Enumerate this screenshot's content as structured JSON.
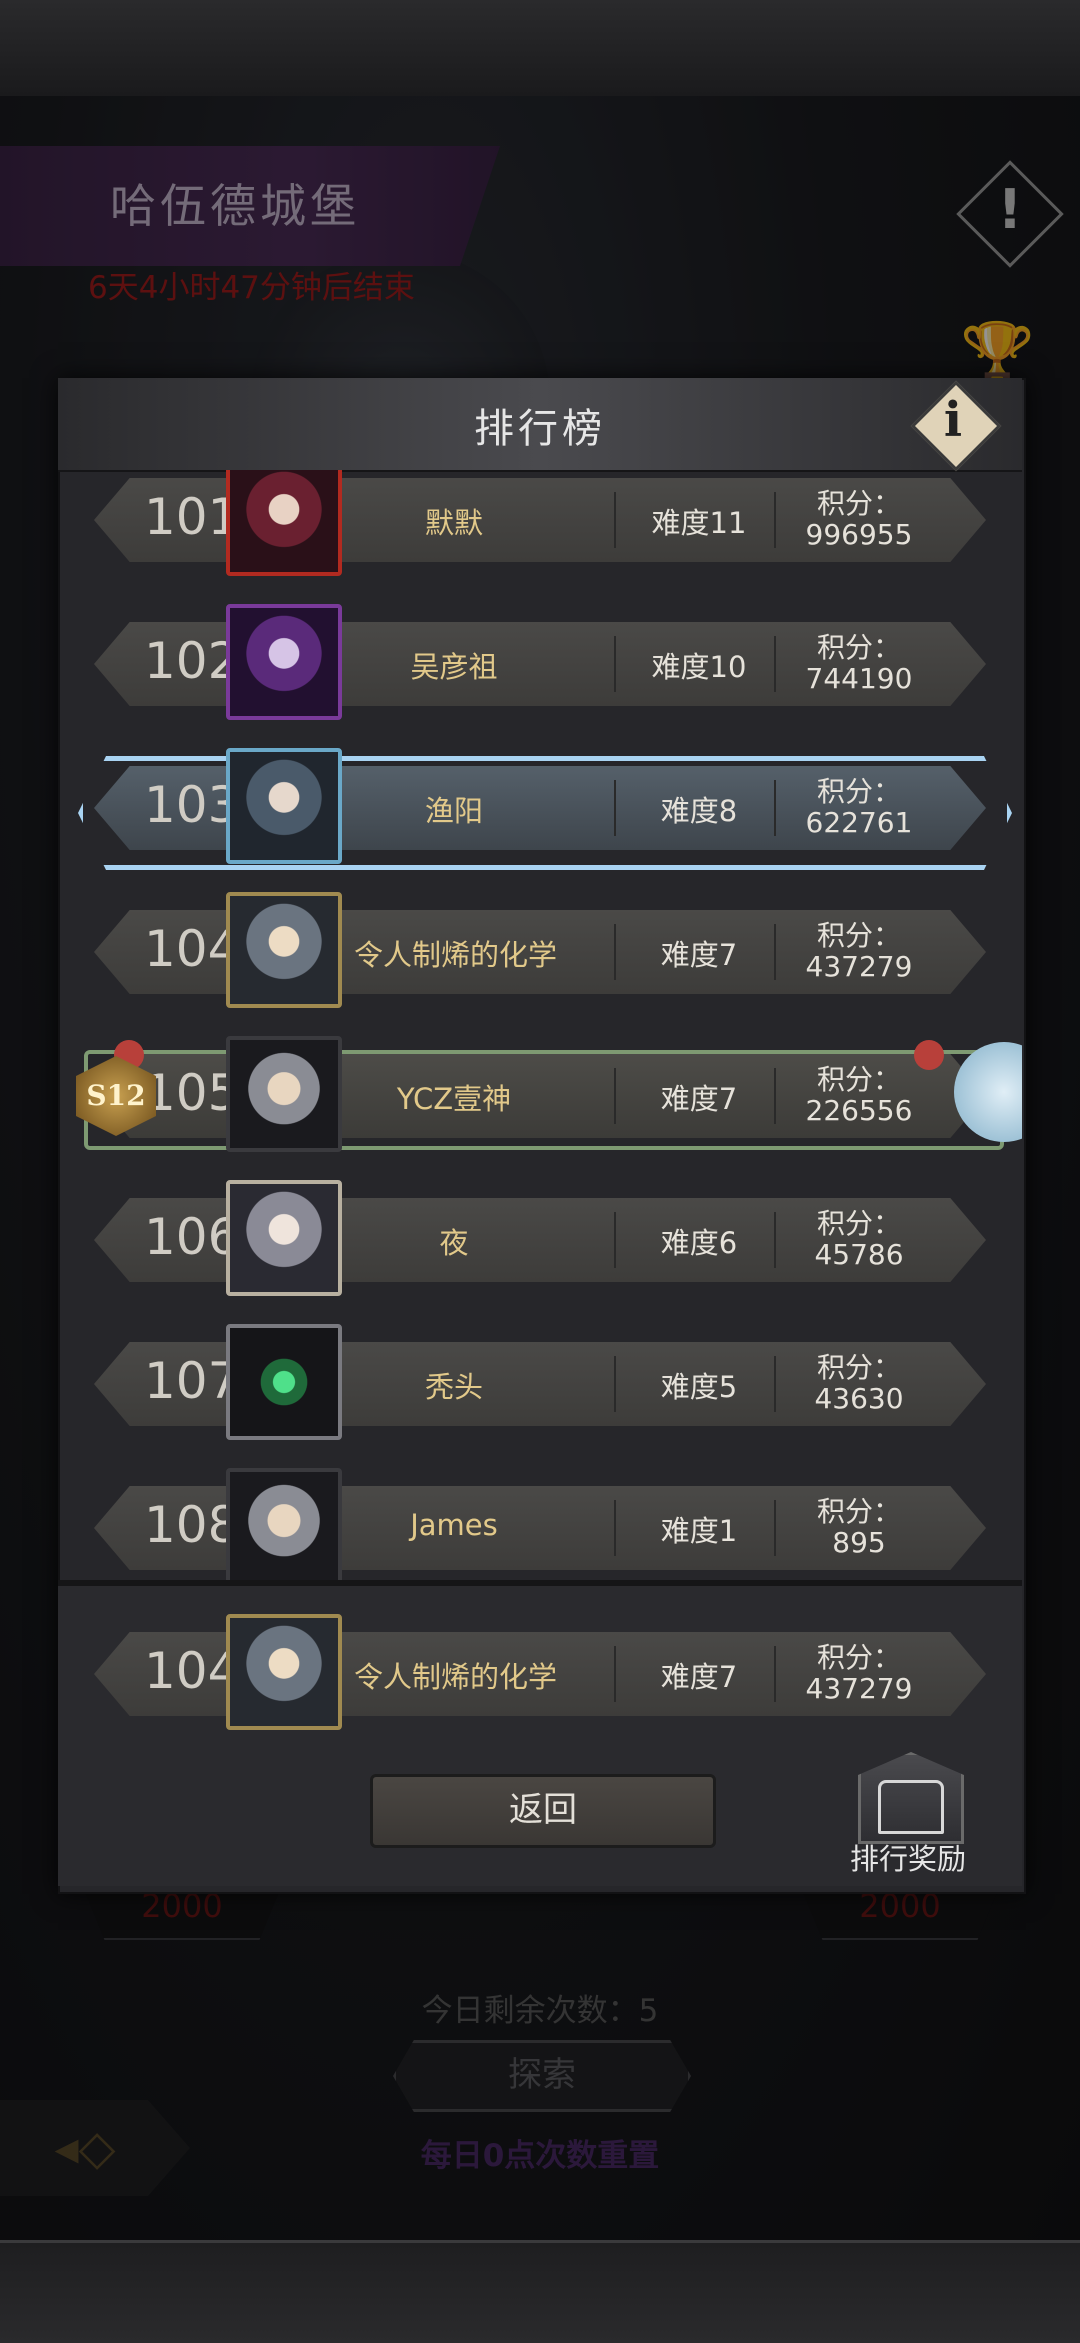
{
  "event": {
    "title": "哈伍德城堡",
    "countdown": "6天4小时47分钟后结束",
    "alert_icon": "!"
  },
  "background": {
    "cost_left": "2000",
    "cost_right": "2000",
    "remaining": "今日剩余次数：5",
    "explore_label": "探索",
    "reset_note": "每日0点次数重置"
  },
  "modal": {
    "title": "排行榜",
    "info_icon": "i",
    "rows": [
      {
        "rank": "101",
        "name": "默默",
        "difficulty": "难度11",
        "score_label": "积分：",
        "score": "996955",
        "avatar": "red"
      },
      {
        "rank": "102",
        "name": "吴彦祖",
        "difficulty": "难度10",
        "score_label": "积分：",
        "score": "744190",
        "avatar": "purple"
      },
      {
        "rank": "103",
        "name": "渔阳",
        "difficulty": "难度8",
        "score_label": "积分：",
        "score": "622761",
        "avatar": "ice"
      },
      {
        "rank": "104",
        "name": "令人制烯的化学",
        "difficulty": "难度7",
        "score_label": "积分：",
        "score": "437279",
        "avatar": "blond"
      },
      {
        "rank": "105",
        "name": "YCZ壹神",
        "difficulty": "难度7",
        "score_label": "积分：",
        "score": "226556",
        "avatar": "hood",
        "badge": "S12"
      },
      {
        "rank": "106",
        "name": "夜",
        "difficulty": "难度6",
        "score_label": "积分：",
        "score": "45786",
        "avatar": "white"
      },
      {
        "rank": "107",
        "name": "秃头",
        "difficulty": "难度5",
        "score_label": "积分：",
        "score": "43630",
        "avatar": "green"
      },
      {
        "rank": "108",
        "name": "James",
        "difficulty": "难度1",
        "score_label": "积分：",
        "score": "895",
        "avatar": "hood"
      }
    ],
    "my_row": {
      "rank": "104",
      "name": "令人制烯的化学",
      "difficulty": "难度7",
      "score_label": "积分：",
      "score": "437279"
    },
    "return_label": "返回",
    "reward_label": "排行奖励"
  }
}
